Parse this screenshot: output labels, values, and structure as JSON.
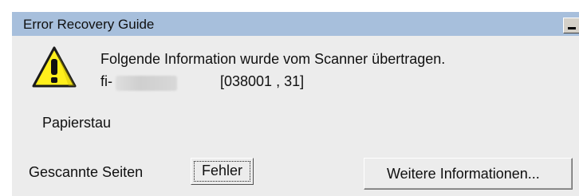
{
  "window": {
    "title": "Error Recovery Guide",
    "title_bar_color": "#a7bfdc",
    "background_color": "#ececec"
  },
  "message": {
    "icon": "warning-icon",
    "line1": "Folgende Information wurde vom Scanner übertragen.",
    "model_prefix": "fi-",
    "error_code": "[038001 , 31]",
    "error_text": "Papierstau"
  },
  "footer": {
    "scanned_pages_label": "Gescannte Seiten",
    "error_button_label": "Fehler",
    "more_info_button_label": "Weitere Informationen..."
  }
}
